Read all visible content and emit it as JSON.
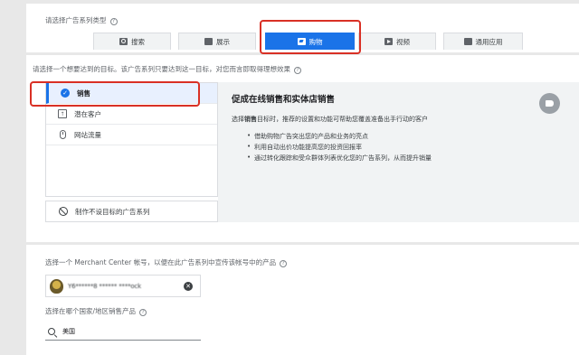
{
  "campaign_type": {
    "heading": "请选择广告系列类型",
    "tabs": [
      {
        "label": "搜索",
        "icon": "search-icon"
      },
      {
        "label": "展示",
        "icon": "display-icon"
      },
      {
        "label": "购物",
        "icon": "shopping-tag-icon",
        "selected": true
      },
      {
        "label": "视频",
        "icon": "video-icon"
      },
      {
        "label": "通用应用",
        "icon": "app-icon"
      }
    ]
  },
  "goals": {
    "heading": "请选择一个想要达到的目标。该广告系列只要达到这一目标，对您而言即取得理想效果",
    "items": [
      {
        "label": "销售",
        "icon": "check-circle-icon",
        "selected": true
      },
      {
        "label": "潜在客户",
        "icon": "lead-icon"
      },
      {
        "label": "网站流量",
        "icon": "mouse-icon"
      }
    ],
    "no_goal_label": "制作不设目标的广告系列"
  },
  "detail": {
    "title": "促成在线销售和实体店销售",
    "desc_prefix": "选择",
    "desc_bold": "销售",
    "desc_suffix": "目标时，推荐的设置和功能可帮助您覆盖准备出手行动的客户",
    "bullets": [
      "借助购物广告突出您的产品和业务的亮点",
      "利用自动出价功能提高您的投资回报率",
      "通过转化跟踪和受众群体列表优化您的广告系列，从而提升销量"
    ]
  },
  "merchant": {
    "heading": "选择一个 Merchant Center 帐号，以便在此广告系列中宣传该帐号中的产品",
    "account_text": "Y6******8 ****** ****ock"
  },
  "country": {
    "heading": "选择在哪个国家/地区销售产品",
    "value": "美国"
  },
  "colors": {
    "accent": "#1a73e8",
    "highlight": "#d93025"
  }
}
